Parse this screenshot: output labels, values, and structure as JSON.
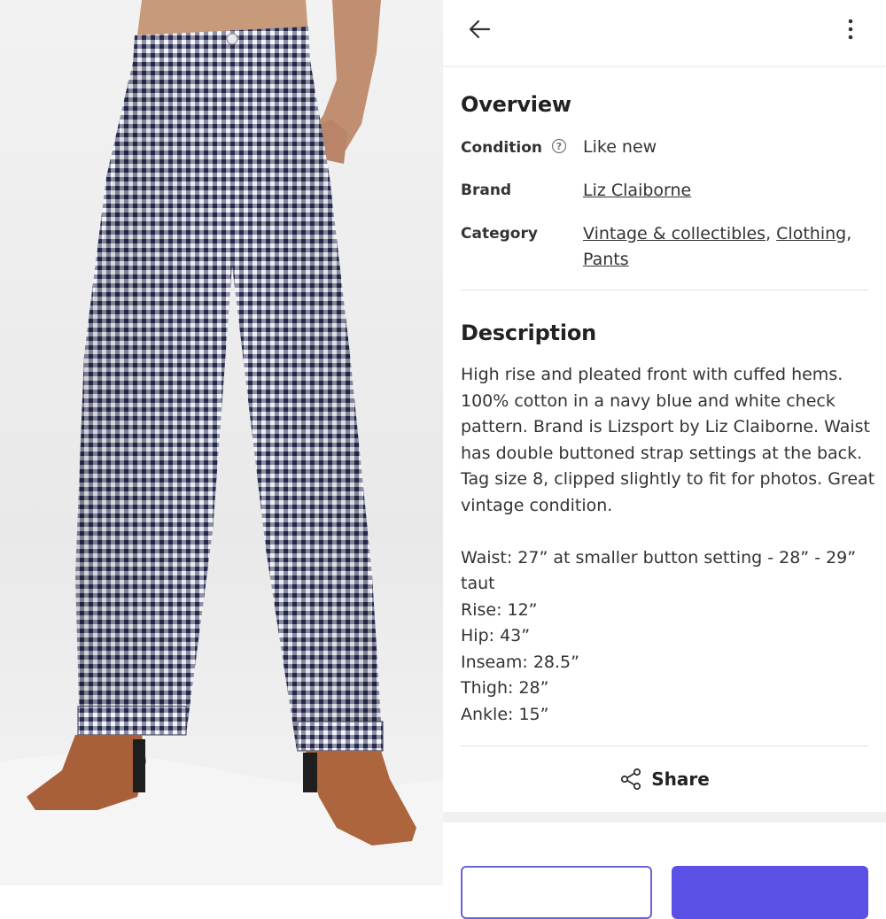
{
  "header": {
    "back_icon": "arrow-left-icon",
    "menu_icon": "more-vertical-icon"
  },
  "overview": {
    "title": "Overview",
    "condition": {
      "label": "Condition",
      "value": "Like new",
      "help_icon": "question-circle-icon"
    },
    "brand": {
      "label": "Brand",
      "value": "Liz Claiborne"
    },
    "category": {
      "label": "Category",
      "values": [
        "Vintage & collectibles",
        "Clothing",
        "Pants"
      ]
    }
  },
  "description": {
    "title": "Description",
    "paragraph": "High rise and pleated front with cuffed hems.  100% cotton in a navy blue and white check pattern.  Brand is Lizsport by Liz Claiborne.  Waist has double buttoned strap settings at the back.  Tag size 8, clipped slightly to fit for photos.  Great vintage condition.",
    "measurements": [
      "Waist: 27” at smaller button setting - 28” - 29” taut",
      "Rise: 12”",
      "Hip: 43”",
      "Inseam: 28.5”",
      "Thigh: 28”",
      "Ankle: 15”"
    ]
  },
  "share": {
    "label": "Share",
    "icon": "share-icon"
  },
  "colors": {
    "accent": "#5a50e6",
    "outline": "#6a64d6"
  }
}
